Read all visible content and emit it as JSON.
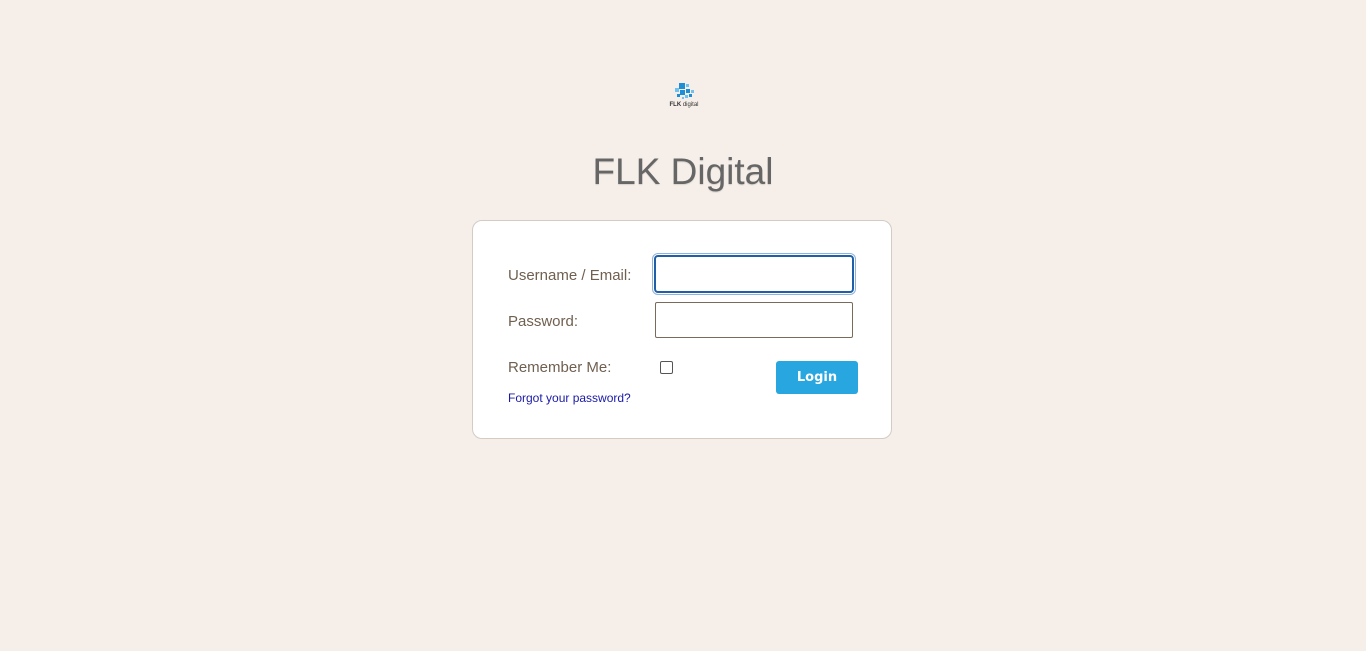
{
  "logo": {
    "brand_bold": "FLK",
    "brand_light": "digital",
    "colors": {
      "primary": "#1e8fd6",
      "light": "#6fc1ef"
    }
  },
  "page": {
    "title": "FLK Digital"
  },
  "form": {
    "username_label": "Username / Email:",
    "username_value": "",
    "password_label": "Password:",
    "password_value": "",
    "remember_label": "Remember Me:",
    "remember_checked": false,
    "forgot_link": "Forgot your password?",
    "login_button": "Login"
  },
  "colors": {
    "background": "#f6efe9",
    "button": "#27a6e0",
    "link": "#1a1aa6",
    "label": "#706050"
  }
}
